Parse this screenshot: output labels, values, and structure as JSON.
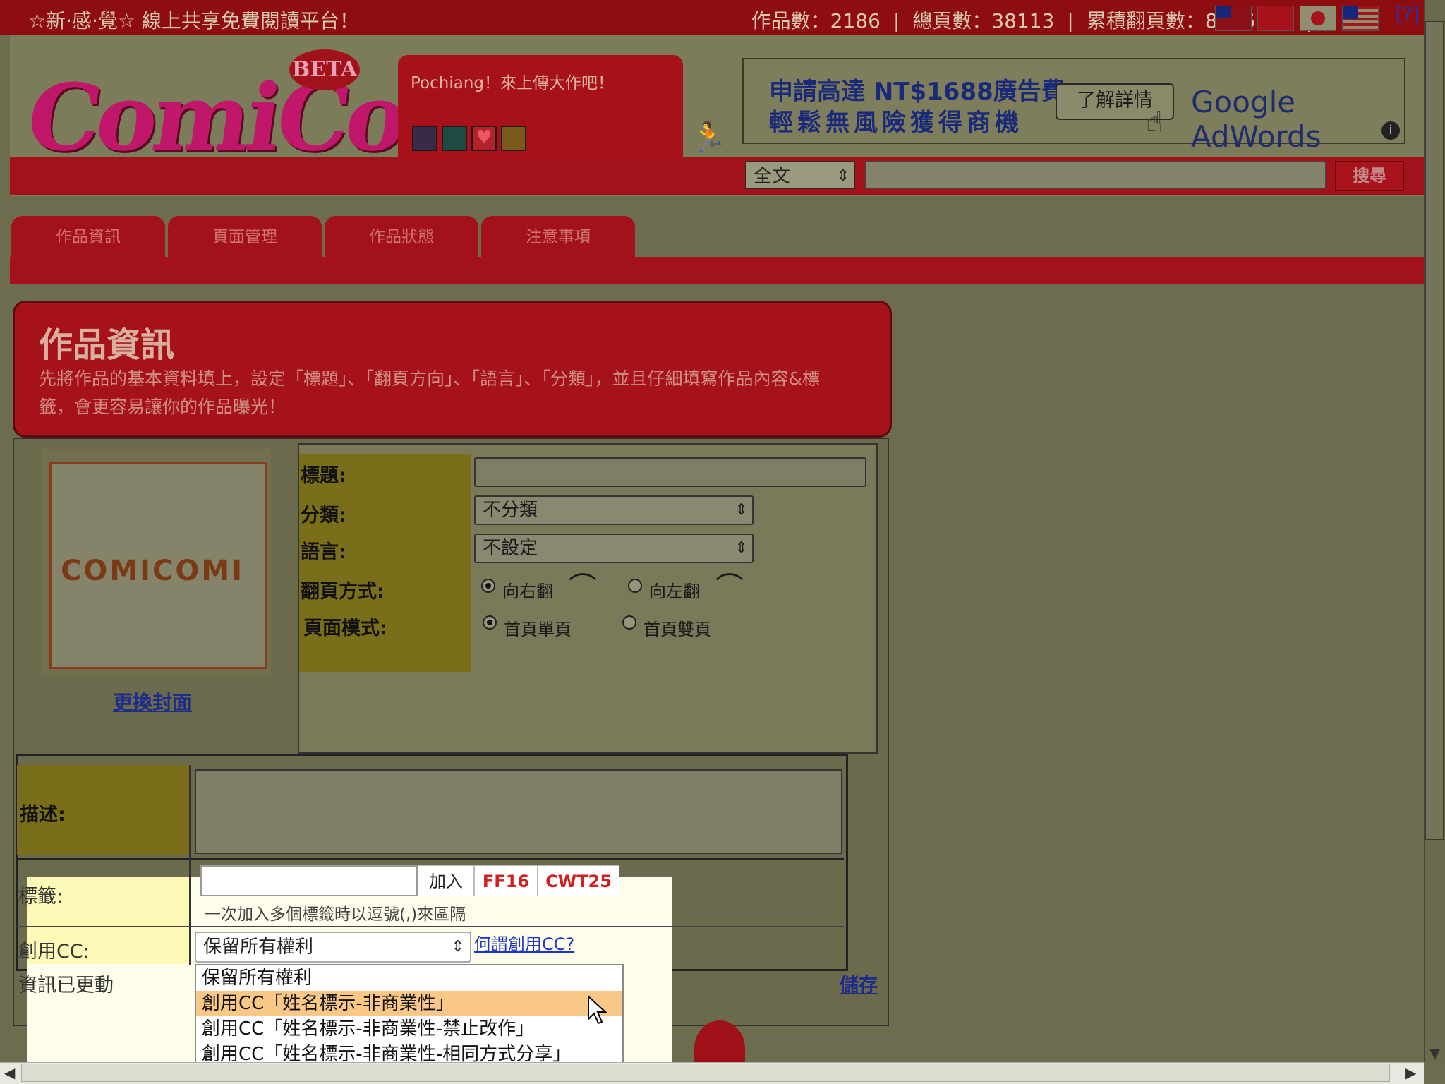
{
  "topbar": {
    "slogan": "☆新·感·覺☆ 線上共享免費閱讀平台！",
    "works_count": "作品數：2186",
    "pages_count": "總頁數：38113",
    "flips_count": "累積翻頁數：8936765",
    "help": "[?]"
  },
  "header": {
    "logo_text": "ComiComi",
    "beta": "BETA",
    "greeting": "Pochiang！來上傳大作吧！"
  },
  "ad": {
    "line1": "申請高達 NT$1688廣告費",
    "line2": "輕鬆無風險獲得商機",
    "button": "了解詳情",
    "brand": "Google AdWords",
    "info": "i"
  },
  "search": {
    "scope": "全文",
    "button": "搜尋"
  },
  "tabs": [
    "作品資訊",
    "頁面管理",
    "作品狀態",
    "注意事項"
  ],
  "info_panel": {
    "title": "作品資訊",
    "description": "先將作品的基本資料填上，設定「標題」、「翻頁方向」、「語言」、「分類」，並且仔細填寫作品內容&標籤，會更容易讓你的作品曝光！"
  },
  "cover": {
    "placeholder": "COMICOMI",
    "change_link": "更換封面"
  },
  "form": {
    "title_label": "標題:",
    "category_label": "分類:",
    "category_value": "不分類",
    "language_label": "語言:",
    "language_value": "不設定",
    "flip_label": "翻頁方式:",
    "flip_right": "向右翻",
    "flip_left": "向左翻",
    "page_mode_label": "頁面模式:",
    "mode_single": "首頁單頁",
    "mode_double": "首頁雙頁",
    "description_label": "描述:",
    "tags_label": "標籤:",
    "add_button": "加入",
    "tag1": "FF16",
    "tag2": "CWT25",
    "tag_hint": "一次加入多個標籤時以逗號(,)來區隔",
    "cc_label": "創用CC:",
    "cc_value": "保留所有權利",
    "cc_link": "何謂創用CC?",
    "status": "資訊已更動",
    "save": "儲存"
  },
  "dropdown": {
    "options": [
      "保留所有權利",
      "創用CC「姓名標示-非商業性」",
      "創用CC「姓名標示-非商業性-禁止改作」",
      "創用CC「姓名標示-非商業性-相同方式分享」"
    ],
    "highlighted_index": 1
  },
  "colors": {
    "brand_red": "#a3121a",
    "highlight": "#f9c887",
    "link_blue": "#1a35c8"
  }
}
